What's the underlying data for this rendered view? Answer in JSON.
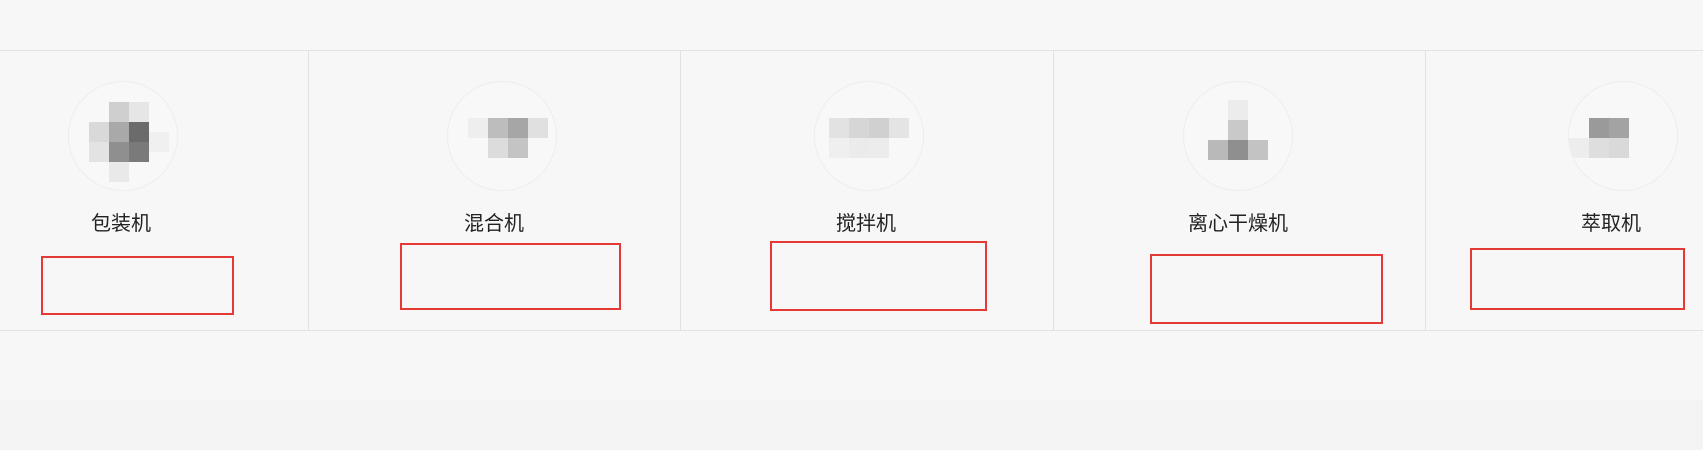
{
  "products": [
    {
      "label": "包装机",
      "image": "product-photo-packaging-machine"
    },
    {
      "label": "混合机",
      "image": "product-photo-mixing-machine"
    },
    {
      "label": "搅拌机",
      "image": "product-photo-stirring-machine"
    },
    {
      "label": "离心干燥机",
      "image": "product-photo-centrifugal-dryer"
    },
    {
      "label": "萃取机",
      "image": "product-photo-extraction-machine"
    }
  ],
  "colors": {
    "background": "#f7f7f7",
    "divider": "#e2e2e2",
    "text": "#222222",
    "highlight_box": "#e53935"
  }
}
